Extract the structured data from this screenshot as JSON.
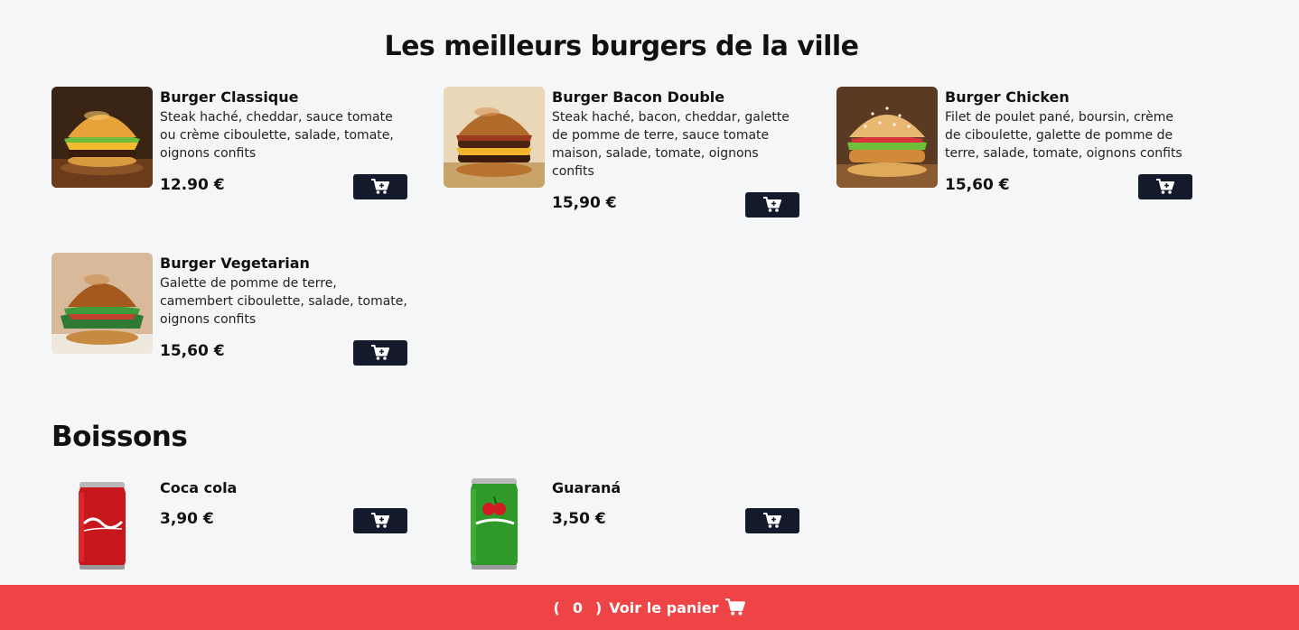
{
  "page": {
    "title": "Les meilleurs burgers de la ville"
  },
  "burgers": [
    {
      "name": "Burger Classique",
      "description": "Steak haché, cheddar, sauce tomate ou crème ciboulette, salade, tomate, oignons confits",
      "price": "12.90 €"
    },
    {
      "name": "Burger Bacon Double",
      "description": "Steak haché, bacon, cheddar, galette de pomme de terre, sauce tomate maison, salade, tomate, oignons confits",
      "price": "15,90 €"
    },
    {
      "name": "Burger Chicken",
      "description": "Filet de poulet pané, boursin, crème de ciboulette, galette de pomme de terre, salade, tomate, oignons confits",
      "price": "15,60 €"
    },
    {
      "name": "Burger Vegetarian",
      "description": "Galette de pomme de terre, camembert ciboulette, salade, tomate, oignons confits",
      "price": "15,60 €"
    }
  ],
  "drinks_section": {
    "title": "Boissons"
  },
  "drinks": [
    {
      "name": "Coca cola",
      "price": "3,90 €"
    },
    {
      "name": "Guaraná",
      "price": "3,50 €"
    }
  ],
  "cart_bar": {
    "open_paren": "(",
    "count": "0",
    "close_paren": ")",
    "label": "Voir le panier",
    "icon": "cart-icon"
  },
  "colors": {
    "accent": "#ef4446",
    "button": "#121a2b",
    "background": "#f5f6f8"
  }
}
